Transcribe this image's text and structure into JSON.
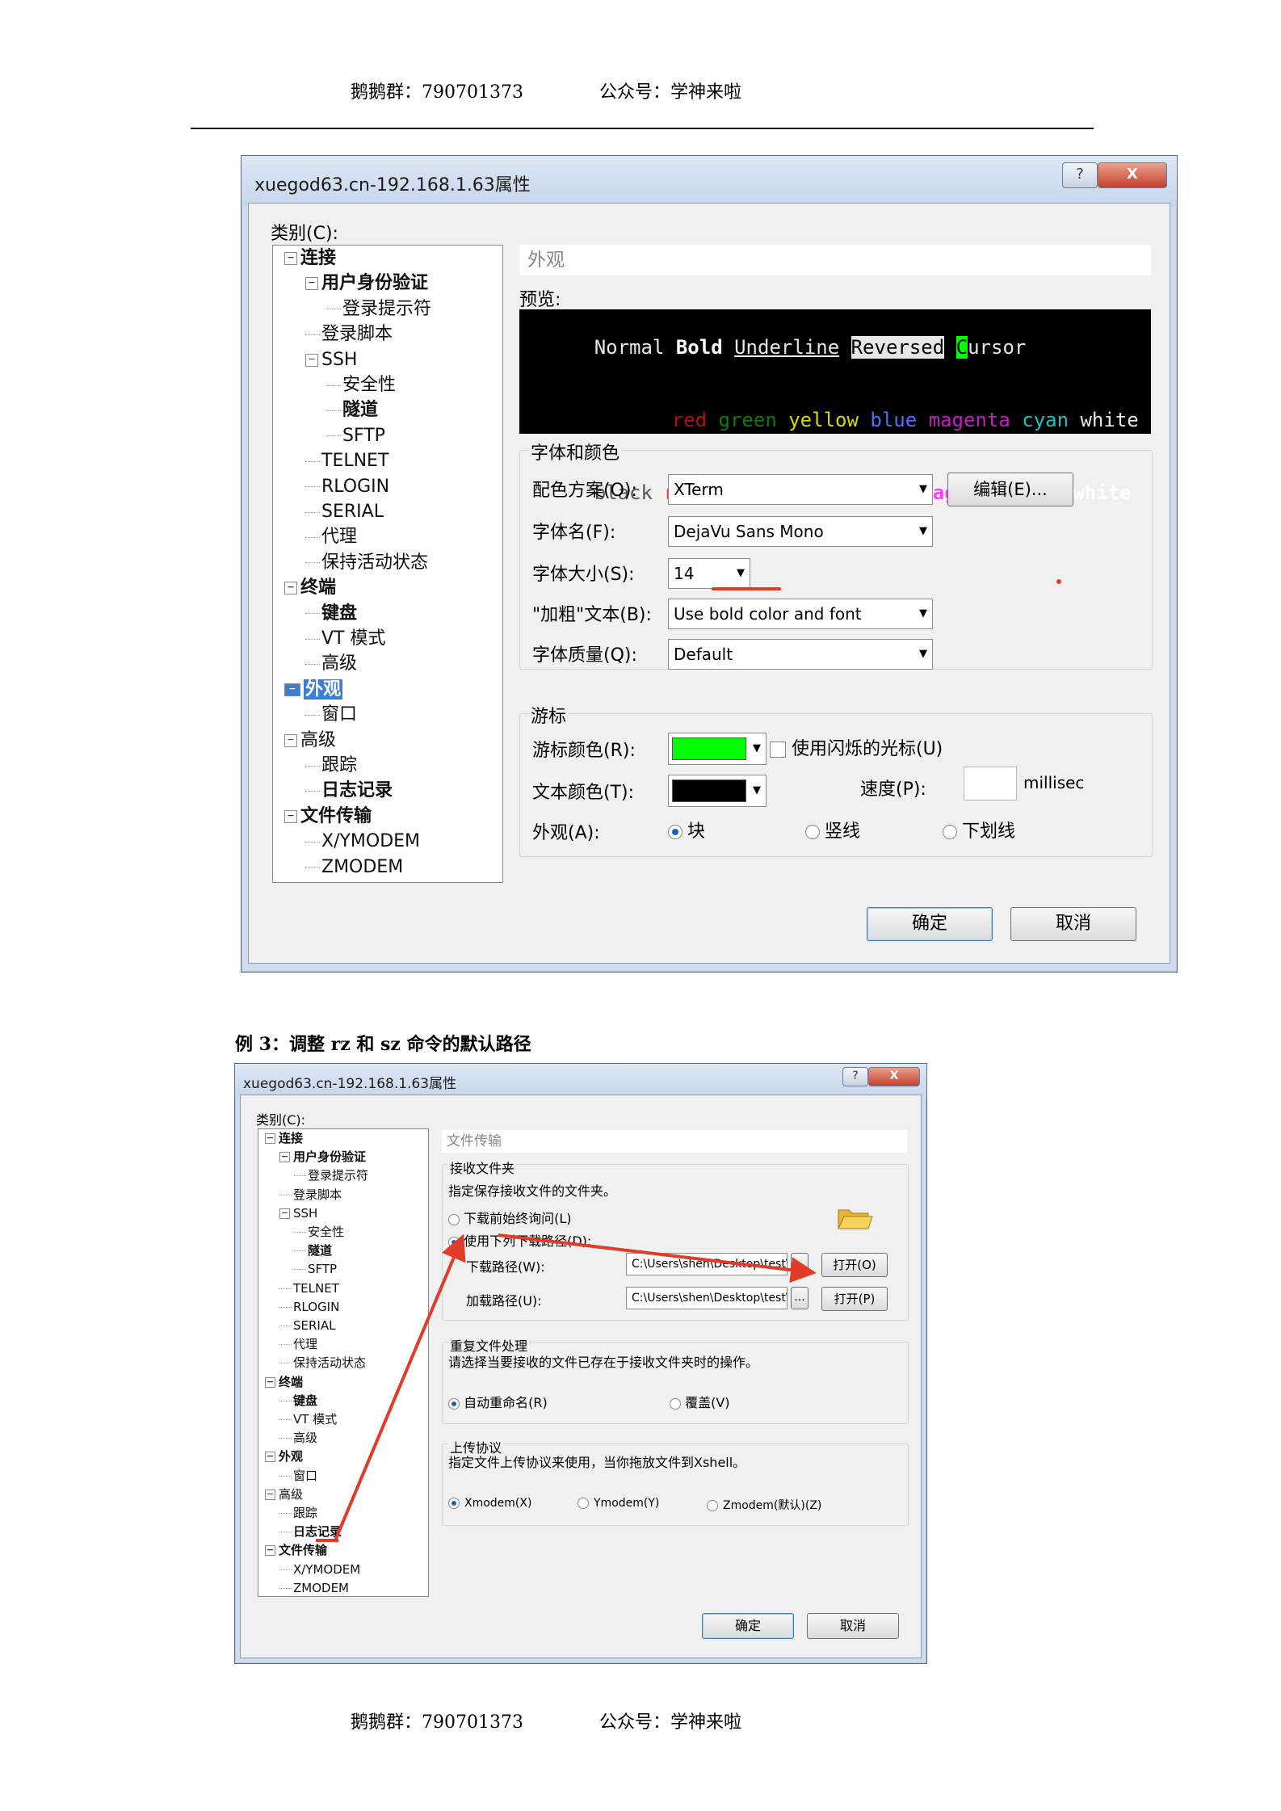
{
  "header": {
    "qq_group": "鹅鹅群：790701373",
    "wechat": "公众号：学神来啦"
  },
  "footer": {
    "qq_group": "鹅鹅群：790701373",
    "wechat": "公众号：学神来啦"
  },
  "caption": "例 3：调整 rz 和 sz  命令的默认路径",
  "colors": {
    "accent": "#3a7fd5",
    "cursor_color": "#00ff00",
    "text_color": "#000000",
    "annotation": "#e23b2a"
  },
  "dialog1": {
    "title": "xuegod63.cn-192.168.1.63属性",
    "help": "?",
    "close": "X",
    "category_label": "类别(C):",
    "tree": [
      {
        "label": "连接",
        "bold": true,
        "exp": "−"
      },
      {
        "label": "用户身份验证",
        "bold": true,
        "exp": "−"
      },
      {
        "label": "登录提示符"
      },
      {
        "label": "登录脚本"
      },
      {
        "label": "SSH",
        "exp": "−"
      },
      {
        "label": "安全性"
      },
      {
        "label": "隧道",
        "bold": true
      },
      {
        "label": "SFTP"
      },
      {
        "label": "TELNET"
      },
      {
        "label": "RLOGIN"
      },
      {
        "label": "SERIAL"
      },
      {
        "label": "代理"
      },
      {
        "label": "保持活动状态"
      },
      {
        "label": "终端",
        "bold": true,
        "exp": "−"
      },
      {
        "label": "键盘",
        "bold": true
      },
      {
        "label": "VT 模式"
      },
      {
        "label": "高级"
      },
      {
        "label": "外观",
        "bold": true,
        "exp": "−",
        "selected": true
      },
      {
        "label": "窗口"
      },
      {
        "label": "高级",
        "exp": "−"
      },
      {
        "label": "跟踪"
      },
      {
        "label": "日志记录",
        "bold": true
      },
      {
        "label": "文件传输",
        "bold": true,
        "exp": "−"
      },
      {
        "label": "X/YMODEM"
      },
      {
        "label": "ZMODEM"
      }
    ],
    "panel_title": "外观",
    "preview_label": "预览:",
    "preview": {
      "normal": "Normal",
      "bold": "Bold",
      "underline": "Underline",
      "reversed": "Reversed",
      "cursor_char": "C",
      "cursor_rest": "ursor",
      "red": "red",
      "green": "green",
      "yellow": "yellow",
      "blue": "blue",
      "magenta": "magenta",
      "cyan": "cyan",
      "white": "white",
      "black": "black"
    },
    "font_group": "字体和颜色",
    "scheme_label": "配色方案(O):",
    "scheme_value": "XTerm",
    "edit_button": "编辑(E)...",
    "font_label": "字体名(F):",
    "font_value": "DejaVu Sans Mono",
    "size_label": "字体大小(S):",
    "size_value": "14",
    "bold_label": "\"加粗\"文本(B):",
    "bold_value": "Use bold color and font",
    "quality_label": "字体质量(Q):",
    "quality_value": "Default",
    "cursor_group": "游标",
    "cursor_color_label": "游标颜色(R):",
    "blink_label": "使用闪烁的光标(U)",
    "text_color_label": "文本颜色(T):",
    "speed_label": "速度(P):",
    "speed_value": "",
    "speed_unit": "millisec",
    "appearance_label": "外观(A):",
    "appearance_options": [
      {
        "label": "块",
        "selected": true
      },
      {
        "label": "竖线",
        "selected": false
      },
      {
        "label": "下划线",
        "selected": false
      }
    ],
    "ok": "确定",
    "cancel": "取消"
  },
  "dialog2": {
    "title": "xuegod63.cn-192.168.1.63属性",
    "help": "?",
    "close": "X",
    "category_label": "类别(C):",
    "tree": [
      {
        "label": "连接",
        "bold": true,
        "exp": "−"
      },
      {
        "label": "用户身份验证",
        "bold": true,
        "exp": "−"
      },
      {
        "label": "登录提示符"
      },
      {
        "label": "登录脚本"
      },
      {
        "label": "SSH",
        "exp": "−"
      },
      {
        "label": "安全性"
      },
      {
        "label": "隧道",
        "bold": true
      },
      {
        "label": "SFTP"
      },
      {
        "label": "TELNET"
      },
      {
        "label": "RLOGIN"
      },
      {
        "label": "SERIAL"
      },
      {
        "label": "代理"
      },
      {
        "label": "保持活动状态"
      },
      {
        "label": "终端",
        "bold": true,
        "exp": "−"
      },
      {
        "label": "键盘",
        "bold": true
      },
      {
        "label": "VT 模式"
      },
      {
        "label": "高级"
      },
      {
        "label": "外观",
        "bold": true,
        "exp": "−"
      },
      {
        "label": "窗口"
      },
      {
        "label": "高级",
        "exp": "−"
      },
      {
        "label": "跟踪"
      },
      {
        "label": "日志记录",
        "bold": true
      },
      {
        "label": "文件传输",
        "bold": true,
        "exp": "−"
      },
      {
        "label": "X/YMODEM"
      },
      {
        "label": "ZMODEM"
      }
    ],
    "panel_title": "文件传输",
    "recv_group": "接收文件夹",
    "recv_desc": "指定保存接收文件的文件夹。",
    "opt_ask": "下载前始终询问(L)",
    "opt_ask_selected": false,
    "opt_use": "使用下列下载路径(D):",
    "opt_use_selected": true,
    "download_label": "下载路径(W):",
    "download_value": "C:\\Users\\shen\\Desktop\\test\\",
    "upload_label": "加载路径(U):",
    "upload_value": "C:\\Users\\shen\\Desktop\\test\\",
    "browse": "...",
    "open_o": "打开(O)",
    "open_p": "打开(P)",
    "dup_group": "重复文件处理",
    "dup_desc": "请选择当要接收的文件已存在于接收文件夹时的操作。",
    "rename": "自动重命名(R)",
    "rename_selected": true,
    "overwrite": "覆盖(V)",
    "overwrite_selected": false,
    "proto_group": "上传协议",
    "proto_desc": "指定文件上传协议来使用，当你拖放文件到Xshell。",
    "protocols": [
      {
        "label": "Xmodem(X)",
        "selected": true
      },
      {
        "label": "Ymodem(Y)",
        "selected": false
      },
      {
        "label": "Zmodem(默认)(Z)",
        "selected": false
      }
    ],
    "ok": "确定",
    "cancel": "取消"
  }
}
